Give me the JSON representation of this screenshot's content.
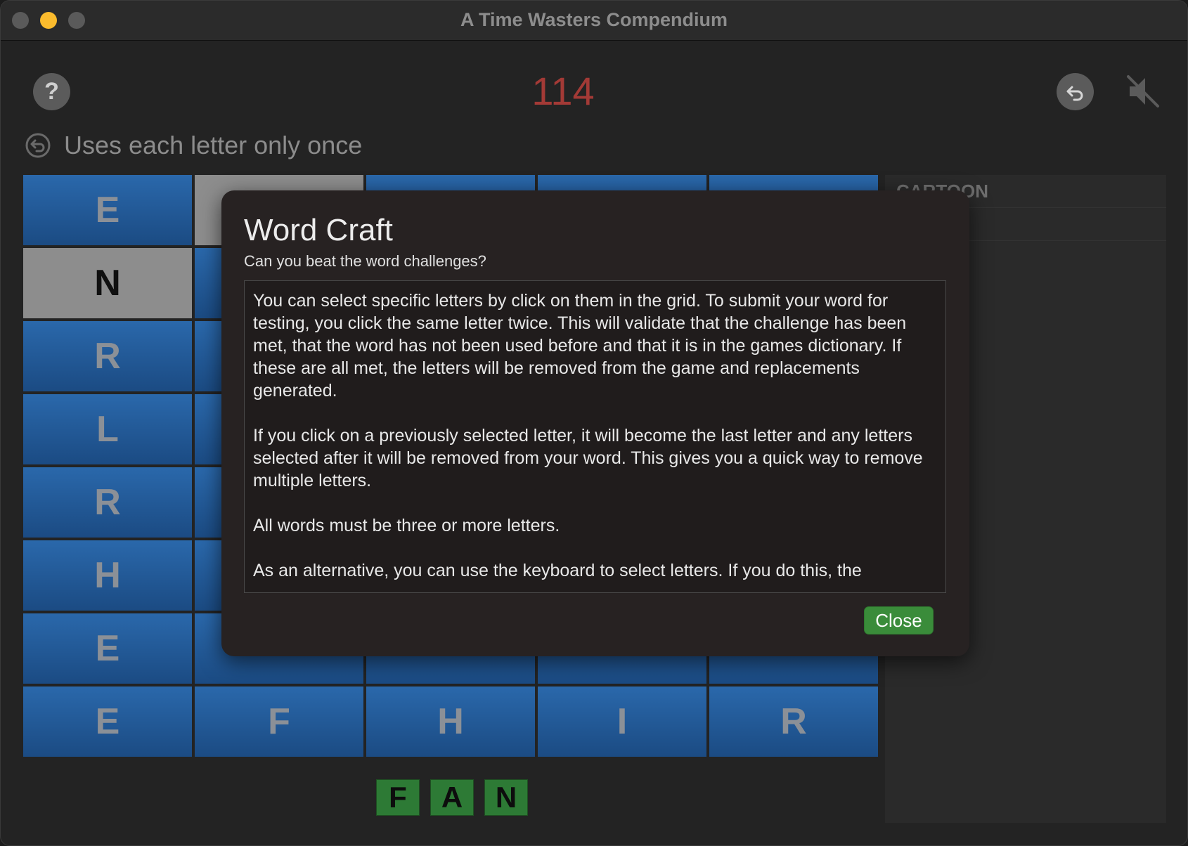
{
  "window": {
    "title": "A Time Wasters Compendium"
  },
  "toolbar": {
    "help_label": "?",
    "score": "114",
    "undo_icon": "undo-icon",
    "mute_icon": "speaker-muted-icon"
  },
  "challenge": {
    "text": "Uses each letter only once"
  },
  "grid": {
    "rows": [
      [
        "E",
        "",
        "",
        "",
        ""
      ],
      [
        "N",
        "",
        "",
        "",
        ""
      ],
      [
        "R",
        "",
        "",
        "",
        ""
      ],
      [
        "L",
        "",
        "",
        "",
        ""
      ],
      [
        "R",
        "",
        "",
        "",
        ""
      ],
      [
        "H",
        "",
        "",
        "",
        ""
      ],
      [
        "E",
        "",
        "",
        "",
        ""
      ],
      [
        "E",
        "F",
        "H",
        "I",
        "R"
      ]
    ],
    "selected_tiles": [
      [
        0,
        1
      ],
      [
        1,
        0
      ]
    ]
  },
  "found_words": [
    "CARTOON",
    ""
  ],
  "current_word": [
    "F",
    "A",
    "N"
  ],
  "dialog": {
    "title": "Word Craft",
    "subtitle": "Can you beat the word challenges?",
    "paragraphs": [
      "You can select specific letters by click on them in the grid. To submit your word for testing, you click the same letter twice. This will validate that the challenge has been met, that the word has not been used before and that it is in the games dictionary. If these are all met, the letters will be removed from the game and replacements generated.",
      "If you click on a previously selected letter, it will become the last letter and any letters selected after it will be removed from your word. This gives you a quick way to remove multiple letters.",
      "All words must be three or more letters.",
      "As an alternative, you can use the  keyboard to select letters. If you do this, the"
    ],
    "close_label": "Close"
  },
  "colors": {
    "score": "#a33a36",
    "tile": "#1f5591",
    "tile_selected": "#8d8d8d",
    "word_tile": "#2d7a35",
    "close_button": "#3a8c3a"
  }
}
